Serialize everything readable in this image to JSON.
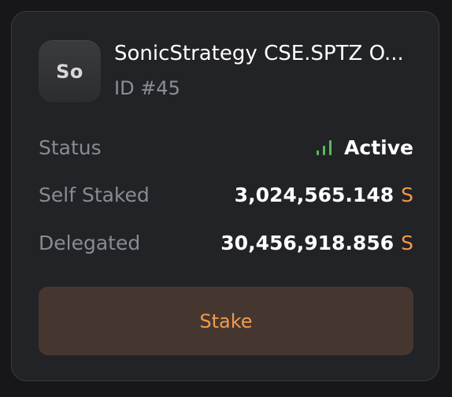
{
  "validator": {
    "avatar_initials": "So",
    "name": "SonicStrategy CSE.SPTZ O...",
    "id_text": "ID #45"
  },
  "status": {
    "label": "Status",
    "value": "Active",
    "icon": "signal-bars-icon",
    "color": "#5cb85c"
  },
  "self_staked": {
    "label": "Self Staked",
    "value": "3,024,565.148",
    "unit": "S"
  },
  "delegated": {
    "label": "Delegated",
    "value": "30,456,918.856",
    "unit": "S"
  },
  "actions": {
    "stake_label": "Stake"
  },
  "colors": {
    "accent": "#f0994a",
    "card_bg": "#222326",
    "button_bg": "#453730"
  }
}
